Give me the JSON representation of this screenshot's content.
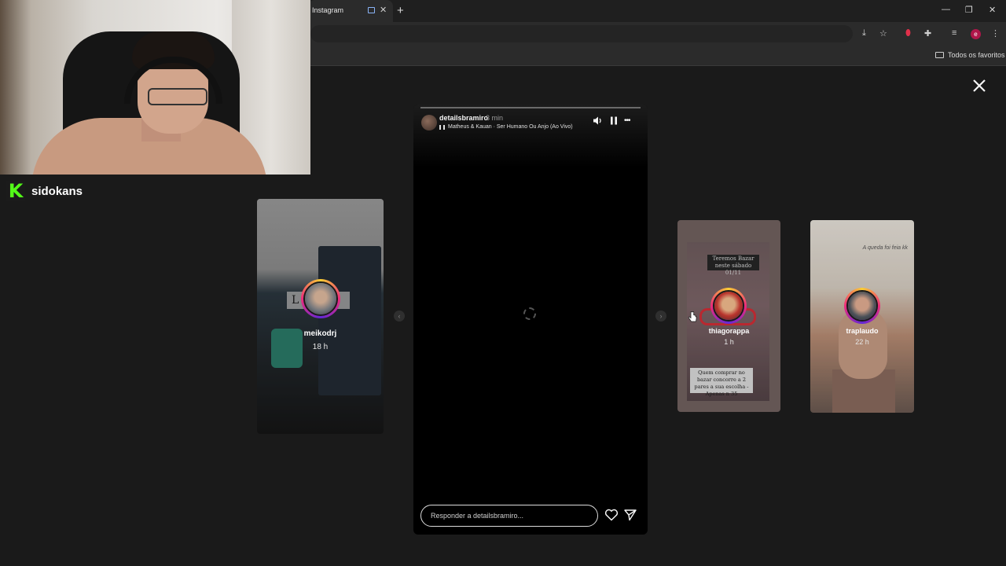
{
  "browser": {
    "tab_title": "Instagram",
    "tab_close": "✕",
    "new_tab": "+",
    "window_controls": {
      "minimize": "—",
      "restore": "❐",
      "close": "✕"
    },
    "bookmarks_folder": "Todos os favoritos",
    "profile_initial": "e"
  },
  "streamer": {
    "logo": "K",
    "name": "sidokans"
  },
  "story": {
    "username": "detailsbramiro",
    "time": "3 min",
    "music": "Matheus & Kauan · Ser Humano Ou Anjo (Ao Vivo)",
    "reply_placeholder": "Responder a detailsbramiro...",
    "more_icon": "•••"
  },
  "previews": [
    {
      "username": "meikodrj",
      "time": "18 h",
      "overlay_text": "L      a"
    },
    {
      "username": "thiagorappa",
      "time": "1 h",
      "banner_text": "Teremos Bazar neste sábado 01/11",
      "caption_text": "Quem comprar no bazar concorre a 2 pares a sua escolha - Apenas n 35"
    },
    {
      "username": "traplaudo",
      "time": "22 h",
      "quote_text": "A queda foi feia kk"
    }
  ],
  "nav": {
    "prev": "‹",
    "next": "›"
  },
  "colors": {
    "kick_green": "#53fc18",
    "story_ring_start": "#f9ce34",
    "story_ring_mid": "#ee2a7b",
    "background": "#1a1a1a"
  }
}
